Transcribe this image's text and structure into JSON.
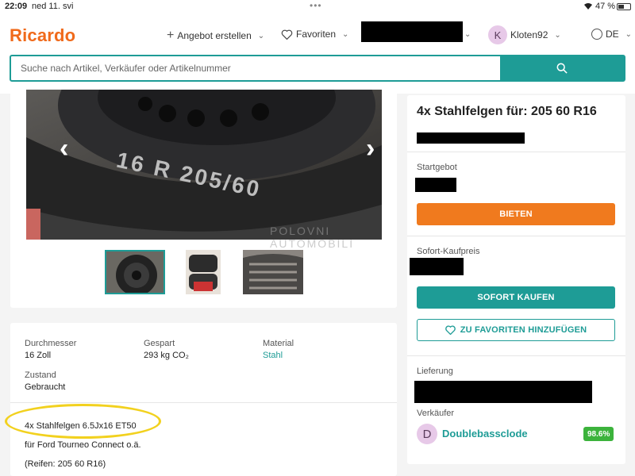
{
  "status_bar": {
    "time": "22:09",
    "date": "ned 11. svi",
    "battery": "47 %"
  },
  "header": {
    "logo": "Ricardo",
    "nav": {
      "sell": "Angebot erstellen",
      "favorites": "Favoriten",
      "user_initial": "K",
      "username": "Kloten92",
      "language": "DE"
    },
    "search": {
      "placeholder": "Suche nach Artikel, Verkäufer oder Artikelnummer"
    }
  },
  "gallery": {
    "thumbnails": [
      "tyre-front",
      "tyre-stack",
      "tyre-tread"
    ],
    "watermark": [
      "POLOVNI",
      "AUTOMOBILI"
    ]
  },
  "details": {
    "attributes": [
      {
        "label": "Durchmesser",
        "value": "16 Zoll"
      },
      {
        "label": "Gespart",
        "value": "293 kg CO₂"
      },
      {
        "label": "Material",
        "value": "Stahl"
      },
      {
        "label": "Zustand",
        "value": "Gebraucht"
      }
    ],
    "description": [
      "4x Stahlfelgen 6.5Jx16 ET50",
      "für Ford Tourneo Connect o.ä.",
      "(Reifen: 205 60 R16)"
    ]
  },
  "listing": {
    "title": "4x Stahlfelgen für: 205 60 R16",
    "start_bid_label": "Startgebot",
    "bid_button": "BIETEN",
    "buy_now_label": "Sofort-Kaufpreis",
    "buy_now_button": "SOFORT KAUFEN",
    "favorite_button": "ZU FAVORITEN HINZUFÜGEN",
    "delivery_label": "Lieferung",
    "seller_label": "Verkäufer",
    "seller": {
      "initial": "D",
      "name": "Doublebassclode",
      "rating": "98.6%"
    }
  },
  "colors": {
    "brand": "#f06a1b",
    "teal": "#1e9c96",
    "bid_orange": "#f07a1e",
    "rating_green": "#3cb33c",
    "annotation_yellow": "#f2d11e"
  }
}
